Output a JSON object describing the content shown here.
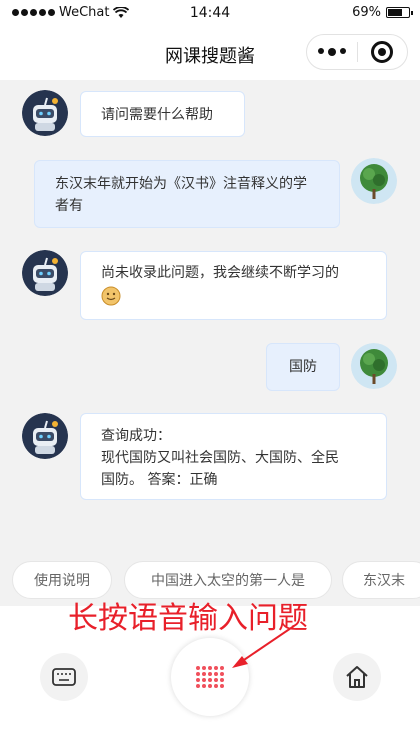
{
  "status_bar": {
    "carrier": "WeChat",
    "time": "14:44",
    "battery": "69%",
    "battery_level": 0.69
  },
  "nav": {
    "title": "网课搜题酱"
  },
  "messages": [
    {
      "role": "bot",
      "text": "请问需要什么帮助"
    },
    {
      "role": "user",
      "text": "东汉末年就开始为《汉书》注音释义的学者有"
    },
    {
      "role": "bot",
      "text": "尚未收录此问题，我会继续不断学习的"
    },
    {
      "role": "user",
      "text": "国防"
    },
    {
      "role": "bot",
      "lines": [
        "查询成功：",
        "现代国防又叫社会国防、大国防、全民",
        "国防。 答案：正确"
      ]
    }
  ],
  "suggestions": [
    "使用说明",
    "中国进入太空的第一人是",
    "东汉末"
  ],
  "annotation": {
    "text": "长按语音输入问题",
    "color": "#e8202a"
  },
  "icons": {
    "keyboard": "keyboard-icon",
    "voice": "voice-dots-icon",
    "home": "home-icon"
  },
  "colors": {
    "bubble_user": "#e7f0fd",
    "bubble_border": "#d7e6fb",
    "voice_accent": "#f0505c"
  }
}
